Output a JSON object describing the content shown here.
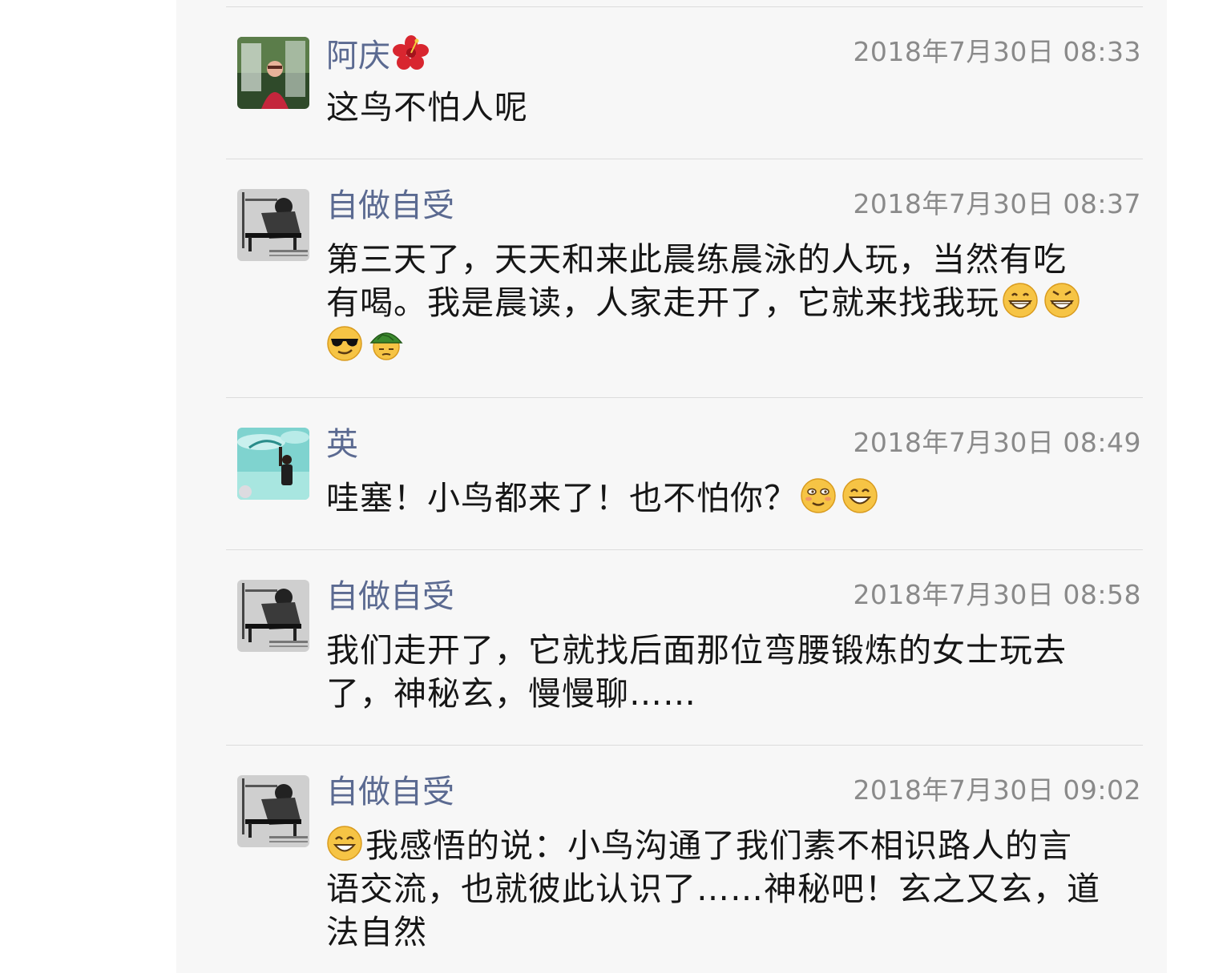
{
  "comments": [
    {
      "author": "阿庆",
      "author_emoji": "hibiscus-icon",
      "timestamp": "2018年7月30日 08:33",
      "text": "这鸟不怕人呢"
    },
    {
      "author": "自做自受",
      "timestamp": "2018年7月30日 08:37",
      "text_line1": "第三天了，天天和来此晨练晨泳的人玩，当然有吃",
      "text_line2": "有喝。我是晨读，人家走开了，它就来找我玩",
      "emojis": [
        "grin-icon",
        "grin-icon",
        "cool-sunglasses-icon",
        "turtle-icon"
      ]
    },
    {
      "author": "英",
      "timestamp": "2018年7月30日 08:49",
      "text": "哇塞！小鸟都来了！也不怕你？",
      "emojis": [
        "blush-smile-icon",
        "smile-icon"
      ]
    },
    {
      "author": "自做自受",
      "timestamp": "2018年7月30日 08:58",
      "text_line1": "我们走开了，它就找后面那位弯腰锻炼的女士玩去",
      "text_line2": "了，神秘玄，慢慢聊……"
    },
    {
      "author": "自做自受",
      "timestamp": "2018年7月30日 09:02",
      "lead_emoji": "smile-icon",
      "text_line1": "我感悟的说：小鸟沟通了我们素不相识路人的言",
      "text_line2": "语交流，也就彼此认识了……神秘吧！玄之又玄，道",
      "text_line3": "法自然"
    }
  ]
}
